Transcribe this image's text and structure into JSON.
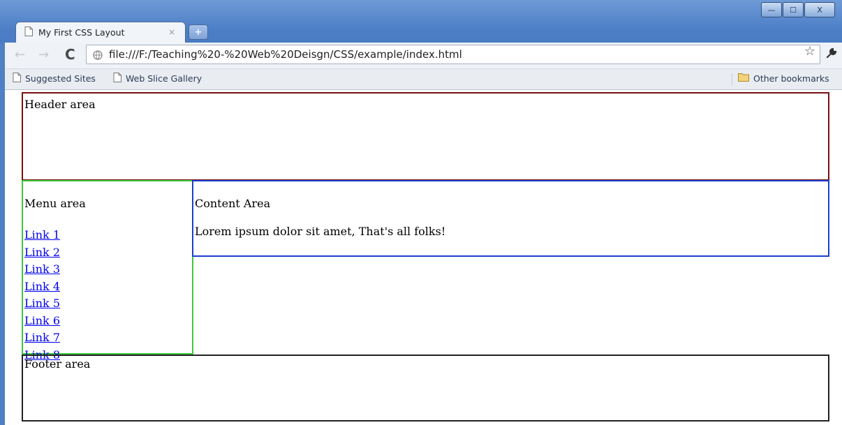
{
  "browser": {
    "tab_title": "My First CSS Layout",
    "tab_close": "×",
    "new_tab": "+",
    "url": "file:///F:/Teaching%20-%20Web%20Deisgn/CSS/example/index.html",
    "window_buttons": {
      "minimize": "—",
      "maximize": "☐",
      "close": "X"
    },
    "nav": {
      "back": "←",
      "forward": "→",
      "reload": "C"
    },
    "bookmarks": [
      {
        "label": "Suggested Sites",
        "icon": "page-icon"
      },
      {
        "label": "Web Slice Gallery",
        "icon": "page-icon"
      }
    ],
    "other_bookmarks": {
      "label": "Other bookmarks",
      "icon": "folder-icon"
    }
  },
  "page": {
    "header": "Header area",
    "menu": {
      "title": "Menu area",
      "links": [
        "Link 1",
        "Link 2",
        "Link 3",
        "Link 4",
        "Link 5",
        "Link 6",
        "Link 7",
        "Link 8"
      ]
    },
    "content": {
      "title": "Content Area",
      "text": "Lorem ipsum dolor sit amet, That's all folks!"
    },
    "footer": "Footer area"
  },
  "colors": {
    "header_border": "#7a1010",
    "menu_border": "#3ec83e",
    "content_border": "#1c3fd0",
    "footer_border": "#222222",
    "link": "#0000ee"
  }
}
